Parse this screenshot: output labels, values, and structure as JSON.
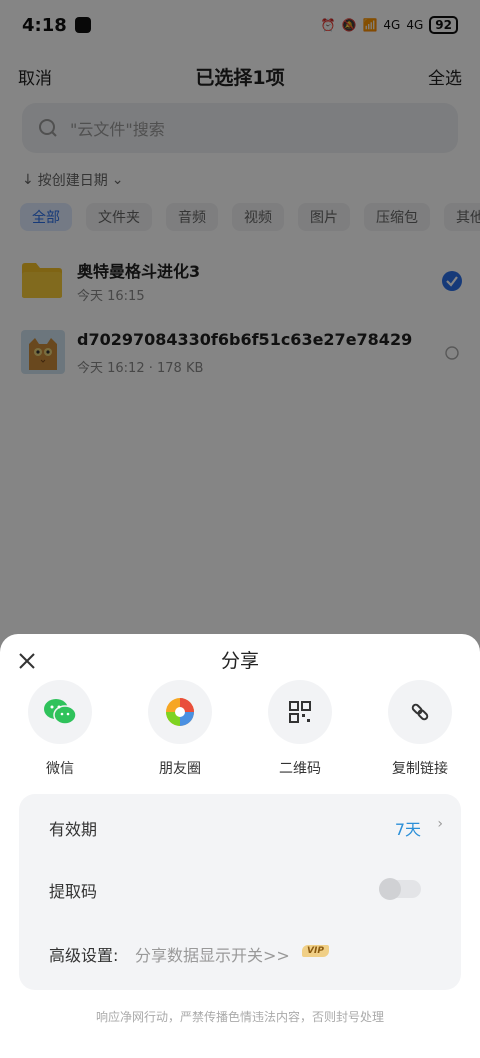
{
  "status": {
    "time": "4:18",
    "battery": "92",
    "net1": "4G",
    "net2": "4G"
  },
  "topbar": {
    "cancel": "取消",
    "title": "已选择1项",
    "select_all": "全选"
  },
  "search": {
    "placeholder": "\"云文件\"搜索"
  },
  "sort": {
    "label": "按创建日期"
  },
  "chips": [
    "全部",
    "文件夹",
    "音频",
    "视频",
    "图片",
    "压缩包",
    "其他"
  ],
  "files": [
    {
      "name": "奥特曼格斗进化3",
      "meta": "今天 16:15",
      "selected": true
    },
    {
      "name": "d70297084330f6b6f51c63e27e78429",
      "meta": "今天 16:12 · 178 KB",
      "selected": false
    }
  ],
  "sheet": {
    "title": "分享",
    "share_items": [
      {
        "label": "微信",
        "icon": "wechat-icon"
      },
      {
        "label": "朋友圈",
        "icon": "moments-icon"
      },
      {
        "label": "二维码",
        "icon": "qrcode-icon"
      },
      {
        "label": "复制链接",
        "icon": "link-icon"
      }
    ],
    "validity_label": "有效期",
    "validity_value": "7天",
    "code_label": "提取码",
    "advanced_label": "高级设置:",
    "advanced_value": "分享数据显示开关>>",
    "vip": "VIP",
    "footer": "响应净网行动，严禁传播色情违法内容，否则封号处理"
  },
  "colors": {
    "accent": "#2b6fe8",
    "blue_text": "#2b8fd8",
    "wechat": "#2fc25b"
  }
}
